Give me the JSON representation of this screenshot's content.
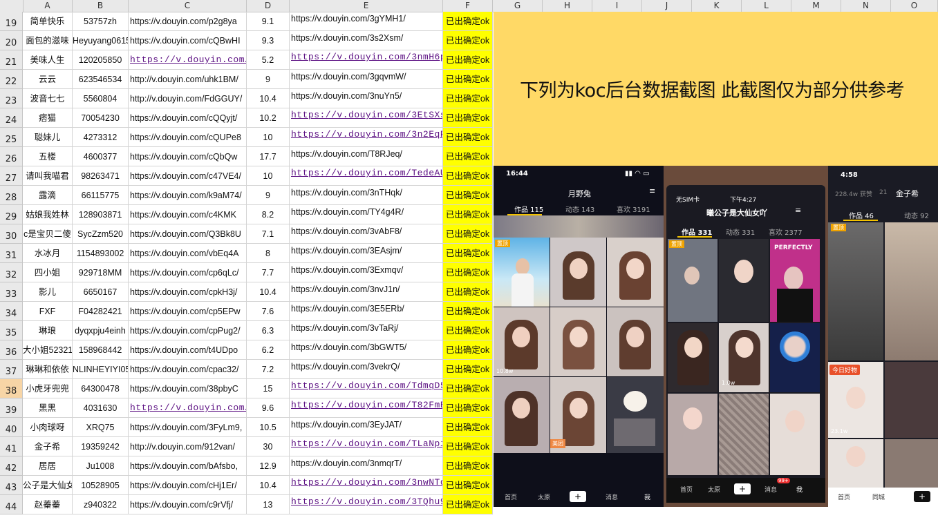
{
  "columns": [
    "A",
    "B",
    "C",
    "D",
    "E",
    "F",
    "G",
    "H",
    "I",
    "J",
    "K",
    "L",
    "M",
    "N",
    "O"
  ],
  "selected_row": "38",
  "rows": [
    {
      "n": "19",
      "a": "简单快乐",
      "b": "53757zh",
      "c": "https://v.douyin.com/p2g8ya",
      "d": "9.1",
      "e": "https://v.douyin.com/3gYMH1/",
      "f": "已出确定ok"
    },
    {
      "n": "20",
      "a": "面包的滋味",
      "b": "Heyuyang0615",
      "c": "https://v.douyin.com/cQBwHI",
      "d": "9.3",
      "e": "https://v.douyin.com/3s2Xsm/",
      "f": "已出确定ok"
    },
    {
      "n": "21",
      "a": "美味人生",
      "b": "120205850",
      "c": "https://v.douyin.com/",
      "d": "5.2",
      "e": "https://v.douyin.com/3nmH6p",
      "f": "已出确定ok",
      "clink": true,
      "elink": true
    },
    {
      "n": "22",
      "a": "云云",
      "b": "623546534",
      "c": "http://v.douyin.com/uhk1BM/",
      "d": "9",
      "e": "https://v.douyin.com/3gqvmW/",
      "f": "已出确定ok"
    },
    {
      "n": "23",
      "a": "波音七七",
      "b": "5560804",
      "c": "http://v.douyin.com/FdGGUY/",
      "d": "10.4",
      "e": "https://v.douyin.com/3nuYn5/",
      "f": "已出确定ok"
    },
    {
      "n": "24",
      "a": "痞猫",
      "b": "70054230",
      "c": "https://v.douyin.com/cQQyjt/",
      "d": "10.2",
      "e": "https://v.douyin.com/3EtSXs",
      "f": "已出确定ok",
      "elink": true
    },
    {
      "n": "25",
      "a": "聪妹儿",
      "b": "4273312",
      "c": "https://v.douyin.com/cQUPe8",
      "d": "10",
      "e": "https://v.douyin.com/3n2EqP",
      "f": "已出确定ok",
      "elink": true
    },
    {
      "n": "26",
      "a": "五楼",
      "b": "4600377",
      "c": "https://v.douyin.com/cQbQw",
      "d": "17.7",
      "e": "https://v.douyin.com/T8RJeq/",
      "f": "已出确定ok"
    },
    {
      "n": "27",
      "a": "请叫我喵君",
      "b": "98263471",
      "c": "https://v.douyin.com/c47VE4/",
      "d": "10",
      "e": "https://v.douyin.com/TedeAU",
      "f": "已出确定ok",
      "elink": true
    },
    {
      "n": "28",
      "a": "露滴",
      "b": "66115775",
      "c": "https://v.douyin.com/k9aM74/",
      "d": "9",
      "e": "https://v.douyin.com/3nTHqk/",
      "f": "已出确定ok"
    },
    {
      "n": "29",
      "a": "姑娘我姓林",
      "b": "128903871",
      "c": "https://v.douyin.com/c4KMK",
      "d": "8.2",
      "e": "https://v.douyin.com/TY4g4R/",
      "f": "已出确定ok"
    },
    {
      "n": "30",
      "a": "c是宝贝二傻",
      "b": "SycZzm520",
      "c": "https://v.douyin.com/Q3Bk8U",
      "d": "7.1",
      "e": "https://v.douyin.com/3vAbF8/",
      "f": "已出确定ok"
    },
    {
      "n": "31",
      "a": "水冰月",
      "b": "1154893002",
      "c": "https://v.douyin.com/vbEq4A",
      "d": "8",
      "e": "https://v.douyin.com/3EAsjm/",
      "f": "已出确定ok"
    },
    {
      "n": "32",
      "a": "四小姐",
      "b": "929718MM",
      "c": "https://v.douyin.com/cp6qLc/",
      "d": "7.7",
      "e": "https://v.douyin.com/3Exmqv/",
      "f": "已出确定ok"
    },
    {
      "n": "33",
      "a": "影儿",
      "b": "6650167",
      "c": "https://v.douyin.com/cpkH3j/",
      "d": "10.4",
      "e": "https://v.douyin.com/3nvJ1n/",
      "f": "已出确定ok"
    },
    {
      "n": "34",
      "a": "FXF",
      "b": "F04282421",
      "c": "https://v.douyin.com/cp5EPw",
      "d": "7.6",
      "e": "https://v.douyin.com/3E5ERb/",
      "f": "已出确定ok"
    },
    {
      "n": "35",
      "a": "琳琅",
      "b": "dyqxpju4einh",
      "c": "https://v.douyin.com/cpPug2/",
      "d": "6.3",
      "e": "https://v.douyin.com/3vTaRj/",
      "f": "已出确定ok"
    },
    {
      "n": "36",
      "a": "大小姐52321",
      "b": "158968442",
      "c": "https://v.douyin.com/t4UDpo",
      "d": "6.2",
      "e": "https://v.douyin.com/3bGWT5/",
      "f": "已出确定ok"
    },
    {
      "n": "37",
      "a": "琳琳和依依",
      "b": "NLINHEYIYI05",
      "c": "https://v.douyin.com/cpac32/",
      "d": "7.2",
      "e": "https://v.douyin.com/3vekrQ/",
      "f": "已出确定ok"
    },
    {
      "n": "38",
      "a": "小虎牙兜兜",
      "b": "64300478",
      "c": "https://v.douyin.com/38pbyC",
      "d": "15",
      "e": "https://v.douyin.com/TdmqD5",
      "f": "已出确定ok",
      "elink": true
    },
    {
      "n": "39",
      "a": "黑黑",
      "b": "4031630",
      "c": "https://v.douyin.com/",
      "d": "9.6",
      "e": "https://v.douyin.com/T82FmE",
      "f": "已出确定ok",
      "clink": true,
      "elink": true
    },
    {
      "n": "40",
      "a": "小肉球呀",
      "b": "XRQ75",
      "c": "https://v.douyin.com/3FyLm9,",
      "d": "10.5",
      "e": "https://v.douyin.com/3EyJAT/",
      "f": "已出确定ok"
    },
    {
      "n": "41",
      "a": "金子希",
      "b": "19359242",
      "c": "http://v.douyin.com/912van/",
      "d": "30",
      "e": "https://v.douyin.com/TLaNpi",
      "f": "已出确定ok",
      "elink": true
    },
    {
      "n": "42",
      "a": "居居",
      "b": "Ju1008",
      "c": "https://v.douyin.com/bAfsbo,",
      "d": "12.9",
      "e": "https://v.douyin.com/3nmqrT/",
      "f": "已出确定ok"
    },
    {
      "n": "43",
      "a": "公子是大仙女",
      "b": "10528905",
      "c": "https://v.douyin.com/cHj1Er/",
      "d": "10.4",
      "e": "https://v.douyin.com/3nwNTd",
      "f": "已出确定ok",
      "elink": true
    },
    {
      "n": "44",
      "a": "赵蓁蓁",
      "b": "z940322",
      "c": "https://v.douyin.com/c9rVfj/",
      "d": "13",
      "e": "https://v.douyin.com/3TQhu9",
      "f": "已出确定ok",
      "elink": true
    }
  ],
  "banner_text": "下列为koc后台数据截图 此截图仅为部分供参考",
  "phone1": {
    "time": "16:44",
    "name": "月野兔",
    "tab1": "作品 115",
    "tab2": "动态 143",
    "tab3": "喜欢 3191",
    "pin": "置顶",
    "play1": "10.8w",
    "nav": [
      "首页",
      "太原",
      "消息",
      "我"
    ],
    "ad": "美团"
  },
  "phone2": {
    "carrier": "无SIM卡",
    "time": "下午4:27",
    "name": "曦公子是大仙女吖",
    "tab1": "作品 331",
    "tab2": "动态 331",
    "tab3": "喜欢 2377",
    "pin": "置顶",
    "perfectly": "PERFECTLY",
    "play1": "1.0w",
    "nav": [
      "首页",
      "太原",
      "消息",
      "我"
    ],
    "badge": "99+"
  },
  "phone3": {
    "time": "4:58",
    "name": "金子希",
    "stat": "228.4w 获赞",
    "stat2": "21",
    "tab1": "作品 46",
    "tab2": "动态 92",
    "pin": "置顶",
    "label": "今日好物",
    "play1": "23.1w",
    "nav": [
      "首页",
      "同城"
    ]
  }
}
